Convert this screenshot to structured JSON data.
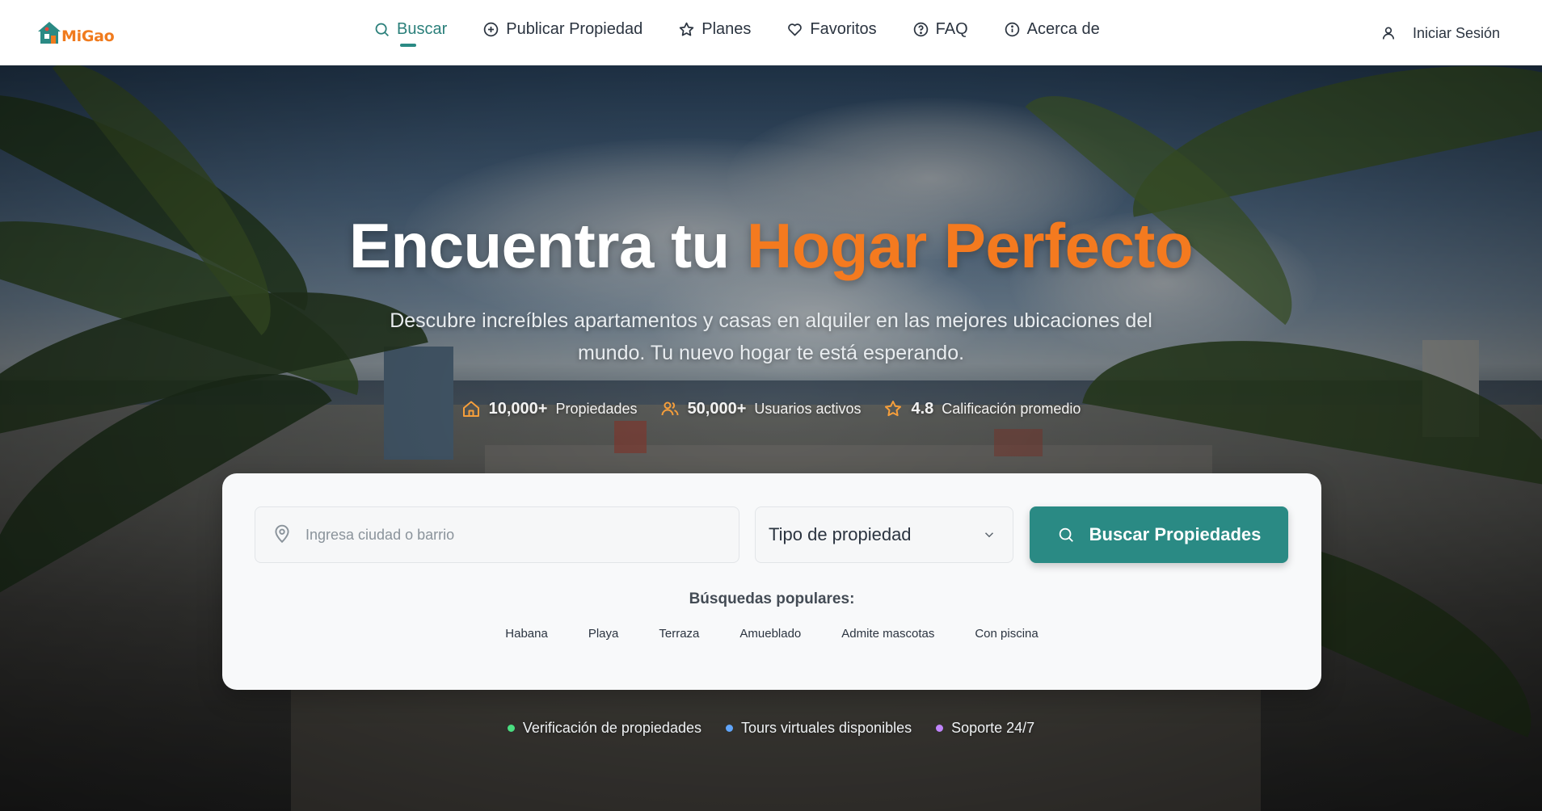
{
  "brand": {
    "name": "MiGao",
    "accent_color": "#f07b1e",
    "primary_color": "#2a8a84"
  },
  "nav": {
    "items": [
      {
        "label": "Buscar",
        "icon": "search-icon",
        "active": true
      },
      {
        "label": "Publicar Propiedad",
        "icon": "plus-circle-icon",
        "active": false
      },
      {
        "label": "Planes",
        "icon": "star-icon",
        "active": false
      },
      {
        "label": "Favoritos",
        "icon": "heart-icon",
        "active": false
      },
      {
        "label": "FAQ",
        "icon": "help-circle-icon",
        "active": false
      },
      {
        "label": "Acerca de",
        "icon": "info-icon",
        "active": false
      }
    ],
    "login_label": "Iniciar Sesión"
  },
  "hero": {
    "title_main": "Encuentra tu ",
    "title_accent": "Hogar Perfecto",
    "subtitle": "Descubre increíbles apartamentos y casas en alquiler en las mejores ubicaciones del mundo. Tu nuevo hogar te está esperando.",
    "stats": [
      {
        "icon": "home-icon",
        "value": "10,000+",
        "label": "Propiedades"
      },
      {
        "icon": "users-icon",
        "value": "50,000+",
        "label": "Usuarios activos"
      },
      {
        "icon": "star-icon",
        "value": "4.8",
        "label": "Calificación promedio"
      }
    ]
  },
  "search": {
    "location_placeholder": "Ingresa ciudad o barrio",
    "location_value": "",
    "type_selected": "Tipo de propiedad",
    "button_label": "Buscar Propiedades",
    "popular_label": "Búsquedas populares:",
    "popular_tags": [
      "Habana",
      "Playa",
      "Terraza",
      "Amueblado",
      "Admite mascotas",
      "Con piscina"
    ]
  },
  "features": [
    {
      "label": "Verificación de propiedades",
      "color": "#4ade80"
    },
    {
      "label": "Tours virtuales disponibles",
      "color": "#60a5fa"
    },
    {
      "label": "Soporte 24/7",
      "color": "#c084fc"
    }
  ]
}
